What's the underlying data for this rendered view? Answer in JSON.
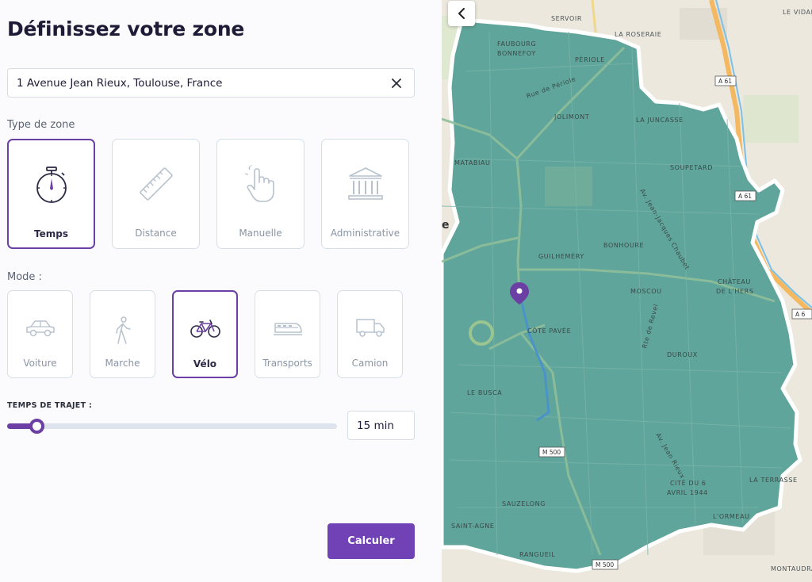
{
  "panel": {
    "title": "Définissez votre zone",
    "address": {
      "value": "1 Avenue Jean Rieux, Toulouse, France"
    },
    "zone_label": "Type de zone",
    "zone_types": [
      {
        "label": "Temps",
        "icon": "stopwatch-icon",
        "selected": true
      },
      {
        "label": "Distance",
        "icon": "ruler-icon",
        "selected": false
      },
      {
        "label": "Manuelle",
        "icon": "hand-pointer-icon",
        "selected": false
      },
      {
        "label": "Administrative",
        "icon": "building-icon",
        "selected": false
      }
    ],
    "mode_label": "Mode :",
    "modes": [
      {
        "label": "Voiture",
        "icon": "car-icon",
        "selected": false
      },
      {
        "label": "Marche",
        "icon": "walking-icon",
        "selected": false
      },
      {
        "label": "Vélo",
        "icon": "bicycle-icon",
        "selected": true
      },
      {
        "label": "Transports",
        "icon": "train-icon",
        "selected": false
      },
      {
        "label": "Camion",
        "icon": "truck-icon",
        "selected": false
      }
    ],
    "travel_time_label": "TEMPS DE TRAJET :",
    "travel_time_value": "15 min",
    "travel_time_fraction": 0.09,
    "calculate_label": "Calculer"
  },
  "map": {
    "labels": {
      "servoir": "SERVOIR",
      "la_roseraie": "LA ROSERAIE",
      "le_vidal": "LE VIDAL",
      "faubourg": "FAUBOURG",
      "bonnefoy": "BONNEFOY",
      "periole": "PÉRIOLE",
      "rue_periole": "Rue de Périole",
      "jolimont": "JOLIMONT",
      "la_juncasse": "LA JUNCASSE",
      "matabiau": "MATABIAU",
      "soupetard": "SOUPETARD",
      "av_jj_chaubet": "Av. Jean-Jacques Chaubet",
      "guilhemery": "GUILHEMÉRY",
      "bonhoure": "BONHOURE",
      "chateau": "CHÂTEAU",
      "de_l_hers": "DE L'HERS",
      "moscou": "MOSCOU",
      "cote_pavee": "CÔTE PAVÉE",
      "rte_revel": "Rte de Revel",
      "duroux": "DUROUX",
      "le_busca": "LE BUSCA",
      "av_jean_rieux": "Av. Jean Rieux",
      "cite_du_6": "CITÉ DU 6",
      "avril_1944": "AVRIL 1944",
      "la_terrasse": "LA TERRASSE",
      "sauzelong": "SAUZELONG",
      "l_ormeau": "L'ORMEAU",
      "saint_agne": "SAINT-AGNE",
      "rangueil": "RANGUEIL",
      "montaudran": "MONTAUDRAN",
      "edge_e": "e"
    },
    "road_shields": [
      "A 61",
      "A 61",
      "M 500",
      "M 500",
      "A 6"
    ],
    "colors": {
      "isochrone": "#5fa59b",
      "accent": "#6b3fa3",
      "button": "#7142b5"
    }
  }
}
